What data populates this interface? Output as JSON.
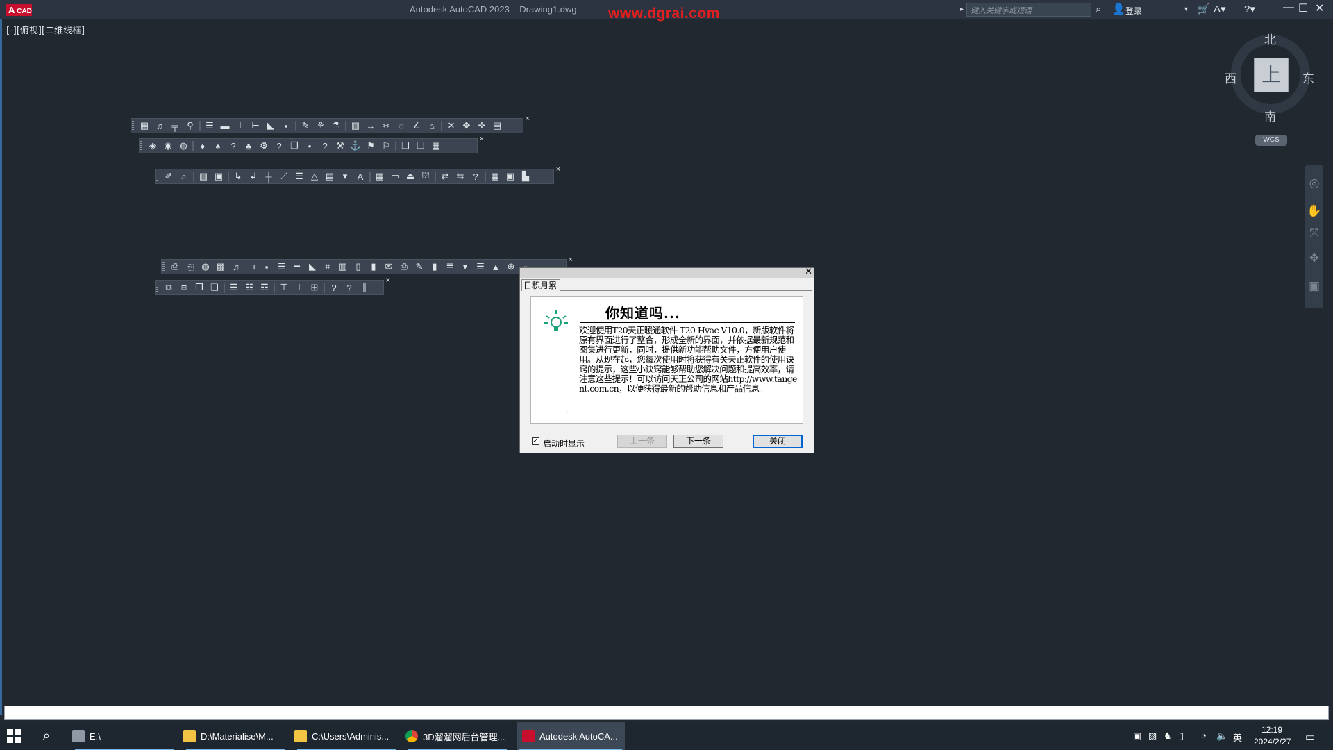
{
  "titlebar": {
    "logo": "A",
    "logo_sub": "CAD",
    "app_title": "Autodesk AutoCAD 2023",
    "doc_title": "Drawing1.dwg",
    "watermark": "www.dgrai.com",
    "search_placeholder": "键入关键字或短语",
    "login": "登录"
  },
  "viewport": {
    "label": "[-][俯视][二维线框]"
  },
  "viewcube": {
    "face": "上",
    "north": "北",
    "south": "南",
    "east": "东",
    "west": "西",
    "ucs": "WCS"
  },
  "dialog": {
    "tab": "日积月累",
    "heading": "你知道吗...",
    "body": "欢迎使用T20天正暖通软件 T20-Hvac V10.0，新版软件将原有界面进行了整合，形成全新的界面，并依据最新规范和图集进行更新，同时，提供新功能帮助文件，方便用户使用。从现在起，您每次使用时将获得有关天正软件的使用诀窍的提示，这些小诀窍能够帮助您解决问题和提高效率，请注意这些提示！可以访问天正公司的网站http://www.tangent.com.cn，以便获得最新的帮助信息和产品信息。",
    "show_on_startup": "启动时显示",
    "show_on_startup_checked": true,
    "prev_button": "上一条",
    "next_button": "下一条",
    "close_button": "关闭"
  },
  "taskbar": {
    "drive": "E:\\",
    "tasks": [
      {
        "label": "D:\\Materialise\\M...",
        "icon": "folder-icon"
      },
      {
        "label": "C:\\Users\\Adminis...",
        "icon": "folder-icon"
      },
      {
        "label": "3D溜溜网后台管理...",
        "icon": "chrome-icon"
      },
      {
        "label": "Autodesk AutoCA...",
        "icon": "autocad-icon"
      }
    ],
    "ime": "英",
    "time": "12:19",
    "date": "2024/2/27"
  },
  "colors": {
    "background": "#212830",
    "titlebar": "#2b3440",
    "autocad_red": "#c8102e",
    "watermark_red": "#e0201f",
    "taskbar": "#1e2630"
  }
}
